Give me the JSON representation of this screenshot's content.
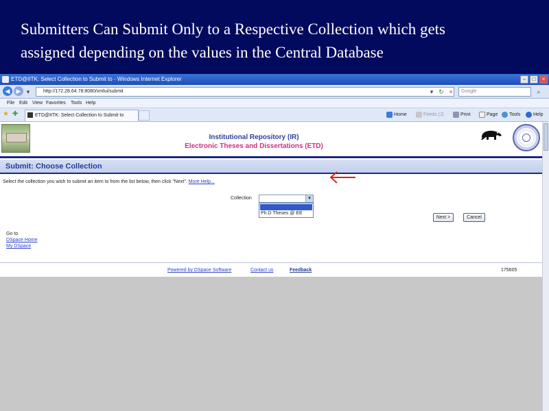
{
  "slide": {
    "title_line1": "Submitters Can Submit Only to a Respective Collection which gets",
    "title_line2": "assigned depending on the values in the Central Database"
  },
  "browser": {
    "window_title": "ETD@IITK: Select Collection to Submit to - Windows Internet Explorer",
    "url": "http://172.28.64.78:8080/xmlui/submit",
    "search_placeholder": "Google",
    "menu": [
      "File",
      "Edit",
      "View",
      "Favorites",
      "Tools",
      "Help"
    ],
    "tab_title": "ETD@IITK: Select Collection to Submit to",
    "commands": {
      "home": "Home",
      "feeds": "Feeds (J)",
      "print": "Print",
      "page": "Page",
      "tools": "Tools",
      "help": "Help"
    }
  },
  "page": {
    "header_line1": "Institutional Repository (IR)",
    "header_line2": "Electronic Theses and Dissertations (ETD)",
    "heading": "Submit: Choose Collection",
    "instruction": "Select the collection you wish to submit an item to from the list below, then click \"Next\".",
    "help_link": "More Help...",
    "collection_label": "Collection",
    "collection_option": "Ph.D Theses @ EE",
    "next_button": "Next >",
    "cancel_button": "Cancel",
    "goto_label": "Go to",
    "goto_links": [
      "DSpace Home",
      "My DSpace"
    ],
    "footer": {
      "powered_by": "Powered by DSpace Software",
      "contact": "Contact us",
      "feedback": "Feedback",
      "count": "175605"
    }
  },
  "colors": {
    "slide_background": "#020a5e",
    "heading_text": "#243c94",
    "etd_title": "#d0307e",
    "link": "#2a3ec8",
    "arrow": "#e0201c"
  }
}
